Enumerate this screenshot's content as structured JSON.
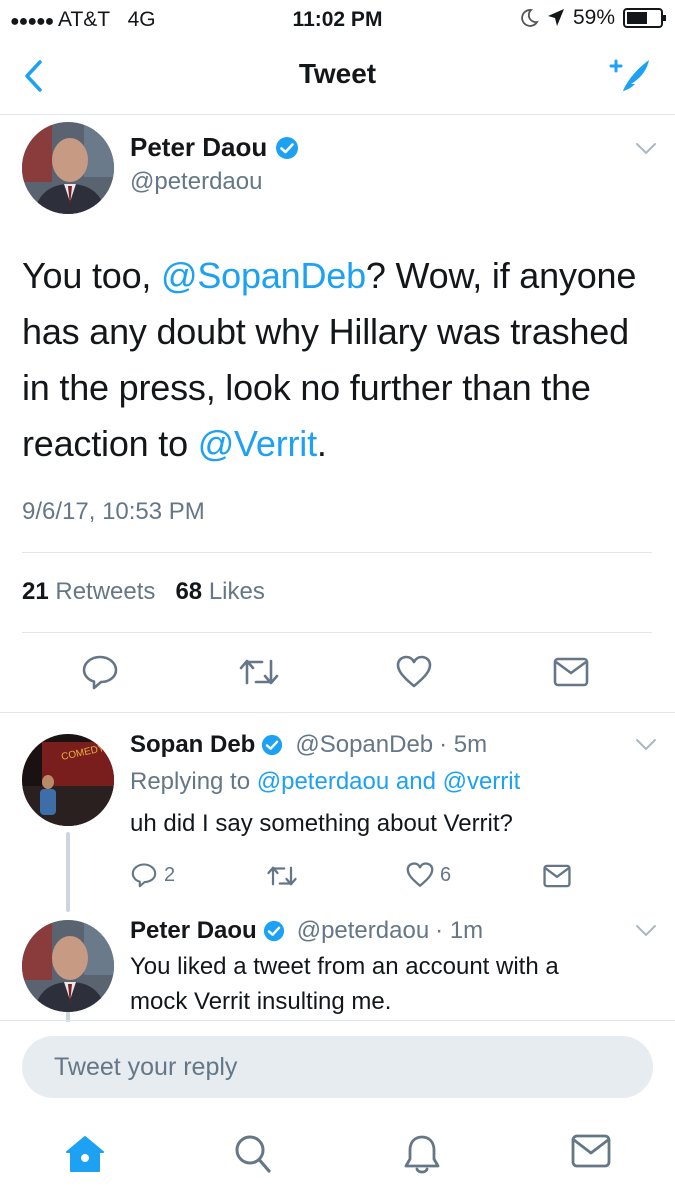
{
  "status_bar": {
    "signal": "●●●●●",
    "carrier": "AT&T",
    "network": "4G",
    "time": "11:02 PM",
    "battery": "59%"
  },
  "nav": {
    "title": "Tweet",
    "back_icon": "chevron-left-icon",
    "compose_icon": "compose-tweet-icon"
  },
  "main_tweet": {
    "author_name": "Peter Daou",
    "author_handle": "@peterdaou",
    "text_parts": {
      "p1": "You too, ",
      "m1": "@SopanDeb",
      "p2": "? Wow, if anyone has any doubt why Hillary was trashed in the press, look no further than the reaction to ",
      "m2": "@Verrit",
      "p3": "."
    },
    "timestamp": "9/6/17, 10:53 PM",
    "retweets_count": "21",
    "retweets_label": "Retweets",
    "likes_count": "68",
    "likes_label": "Likes"
  },
  "replies": [
    {
      "author_name": "Sopan Deb",
      "author_handle": "@SopanDeb",
      "time": "· 5m",
      "replying_prefix": "Replying to",
      "replying_to": "@peterdaou and @verrit",
      "text": "uh did I say something about Verrit?",
      "reply_count": "2",
      "like_count": "6"
    },
    {
      "author_name": "Peter Daou",
      "author_handle": "@peterdaou",
      "time": "· 1m",
      "text_line1": "You liked a tweet from an account with a",
      "text_line2": "mock Verrit insulting me."
    }
  ],
  "reply_box": {
    "placeholder": "Tweet your reply"
  },
  "tab_bar": [
    "home-icon",
    "search-icon",
    "notifications-icon",
    "messages-icon"
  ],
  "colors": {
    "accent": "#1da1f2",
    "text": "#14171a",
    "muted": "#657786",
    "divider": "#e1e8ed"
  }
}
